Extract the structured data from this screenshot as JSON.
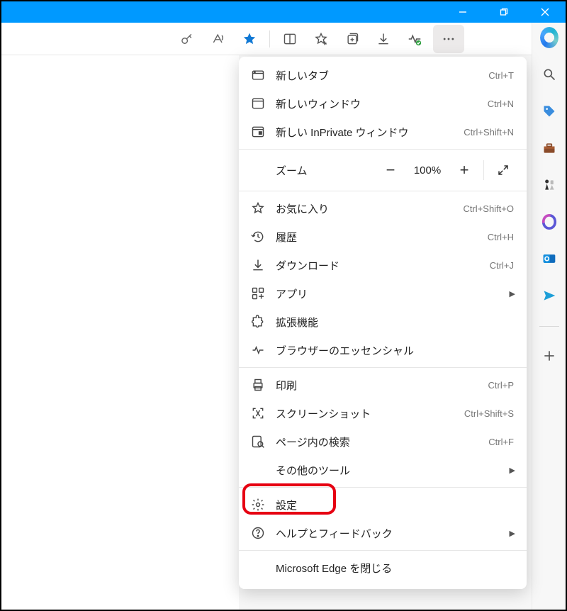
{
  "toolbar": {
    "icons": [
      "key-icon",
      "read-aloud-icon",
      "favorite-star-icon",
      "split-screen-icon",
      "favorites-icon",
      "collections-icon",
      "downloads-icon",
      "browser-essentials-icon",
      "more-icon"
    ]
  },
  "menu": {
    "groups": [
      [
        {
          "icon": "new-tab-icon",
          "label": "新しいタブ",
          "shortcut": "Ctrl+T"
        },
        {
          "icon": "new-window-icon",
          "label": "新しいウィンドウ",
          "shortcut": "Ctrl+N"
        },
        {
          "icon": "inprivate-icon",
          "label": "新しい InPrivate ウィンドウ",
          "shortcut": "Ctrl+Shift+N"
        }
      ],
      [
        {
          "type": "zoom",
          "label": "ズーム",
          "value": "100%"
        }
      ],
      [
        {
          "icon": "star-outline-icon",
          "label": "お気に入り",
          "shortcut": "Ctrl+Shift+O"
        },
        {
          "icon": "history-icon",
          "label": "履歴",
          "shortcut": "Ctrl+H"
        },
        {
          "icon": "download-icon",
          "label": "ダウンロード",
          "shortcut": "Ctrl+J"
        },
        {
          "icon": "apps-icon",
          "label": "アプリ",
          "submenu": true
        },
        {
          "icon": "extensions-icon",
          "label": "拡張機能"
        },
        {
          "icon": "heartbeat-icon",
          "label": "ブラウザーのエッセンシャル"
        }
      ],
      [
        {
          "icon": "print-icon",
          "label": "印刷",
          "shortcut": "Ctrl+P"
        },
        {
          "icon": "screenshot-icon",
          "label": "スクリーンショット",
          "shortcut": "Ctrl+Shift+S"
        },
        {
          "icon": "find-icon",
          "label": "ページ内の検索",
          "shortcut": "Ctrl+F"
        },
        {
          "icon": "",
          "label": "その他のツール",
          "submenu": true
        }
      ],
      [
        {
          "icon": "gear-icon",
          "label": "設定",
          "highlight": true
        },
        {
          "icon": "help-icon",
          "label": "ヘルプとフィードバック",
          "submenu": true
        }
      ],
      [
        {
          "icon": "",
          "label": "Microsoft Edge を閉じる"
        }
      ]
    ]
  },
  "sidebar": {
    "items": [
      "copilot-icon",
      "search-icon",
      "shopping-tag-icon",
      "toolbox-icon",
      "games-icon",
      "m365-icon",
      "outlook-icon",
      "send-icon",
      "add-icon"
    ]
  },
  "window_controls": {
    "minimize": "—",
    "maximize": "❐",
    "close": "✕"
  }
}
